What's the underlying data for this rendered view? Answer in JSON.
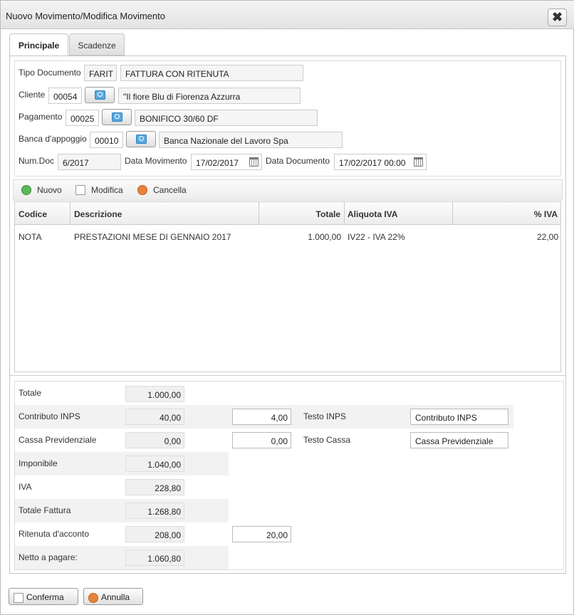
{
  "window": {
    "title": "Nuovo Movimento/Modifica Movimento",
    "close_glyph": "✖"
  },
  "tabs": [
    {
      "label": "Principale"
    },
    {
      "label": "Scadenze"
    }
  ],
  "form": {
    "tipo_documento": {
      "label": "Tipo Documento",
      "code": "FARIT",
      "description": "FATTURA CON RITENUTA"
    },
    "cliente": {
      "label": "Cliente",
      "code": "00054",
      "description": "\"Il fiore Blu di Fiorenza Azzurra"
    },
    "pagamento": {
      "label": "Pagamento",
      "code": "00025",
      "description": "BONIFICO 30/60 DF"
    },
    "banca": {
      "label": "Banca d'appoggio",
      "code": "00010",
      "description": "Banca Nazionale del Lavoro Spa"
    },
    "num_doc": {
      "label": "Num.Doc",
      "value": "6/2017"
    },
    "data_movimento": {
      "label": "Data Movimento",
      "value": "17/02/2017"
    },
    "data_documento": {
      "label": "Data Documento",
      "value": "17/02/2017 00:00"
    }
  },
  "toolbar": {
    "nuovo": "Nuovo",
    "modifica": "Modifica",
    "cancella": "Cancella"
  },
  "grid": {
    "columns": [
      "Codice",
      "Descrizione",
      "Totale",
      "Aliquota IVA",
      "% IVA"
    ],
    "rows": [
      [
        "NOTA",
        "PRESTAZIONI MESE DI GENNAIO 2017",
        "1.000,00",
        "IV22 - IVA 22%",
        "22,00"
      ]
    ]
  },
  "totals": {
    "totale": {
      "label": "Totale",
      "value": "1.000,00"
    },
    "contributo_inps": {
      "label": "Contributo INPS",
      "value": "40,00",
      "rate": "4,00",
      "text_label": "Testo INPS",
      "text_value": "Contributo INPS"
    },
    "cassa_previdenziale": {
      "label": "Cassa Previdenziale",
      "value": "0,00",
      "rate": "0,00",
      "text_label": "Testo Cassa",
      "text_value": "Cassa Previdenziale"
    },
    "imponibile": {
      "label": "Imponibile",
      "value": "1.040,00"
    },
    "iva": {
      "label": "IVA",
      "value": "228,80"
    },
    "totale_fattura": {
      "label": "Totale Fattura",
      "value": "1.268,80"
    },
    "ritenuta": {
      "label": "Ritenuta d'acconto",
      "value": "208,00",
      "rate": "20,00"
    },
    "netto": {
      "label": "Netto a pagare:",
      "value": "1.060,80"
    }
  },
  "buttons": {
    "conferma": "Conferma",
    "annulla": "Annulla"
  },
  "colors": {
    "add": "#5cb85c",
    "delete": "#e8823a",
    "search": "#5aa9df"
  }
}
